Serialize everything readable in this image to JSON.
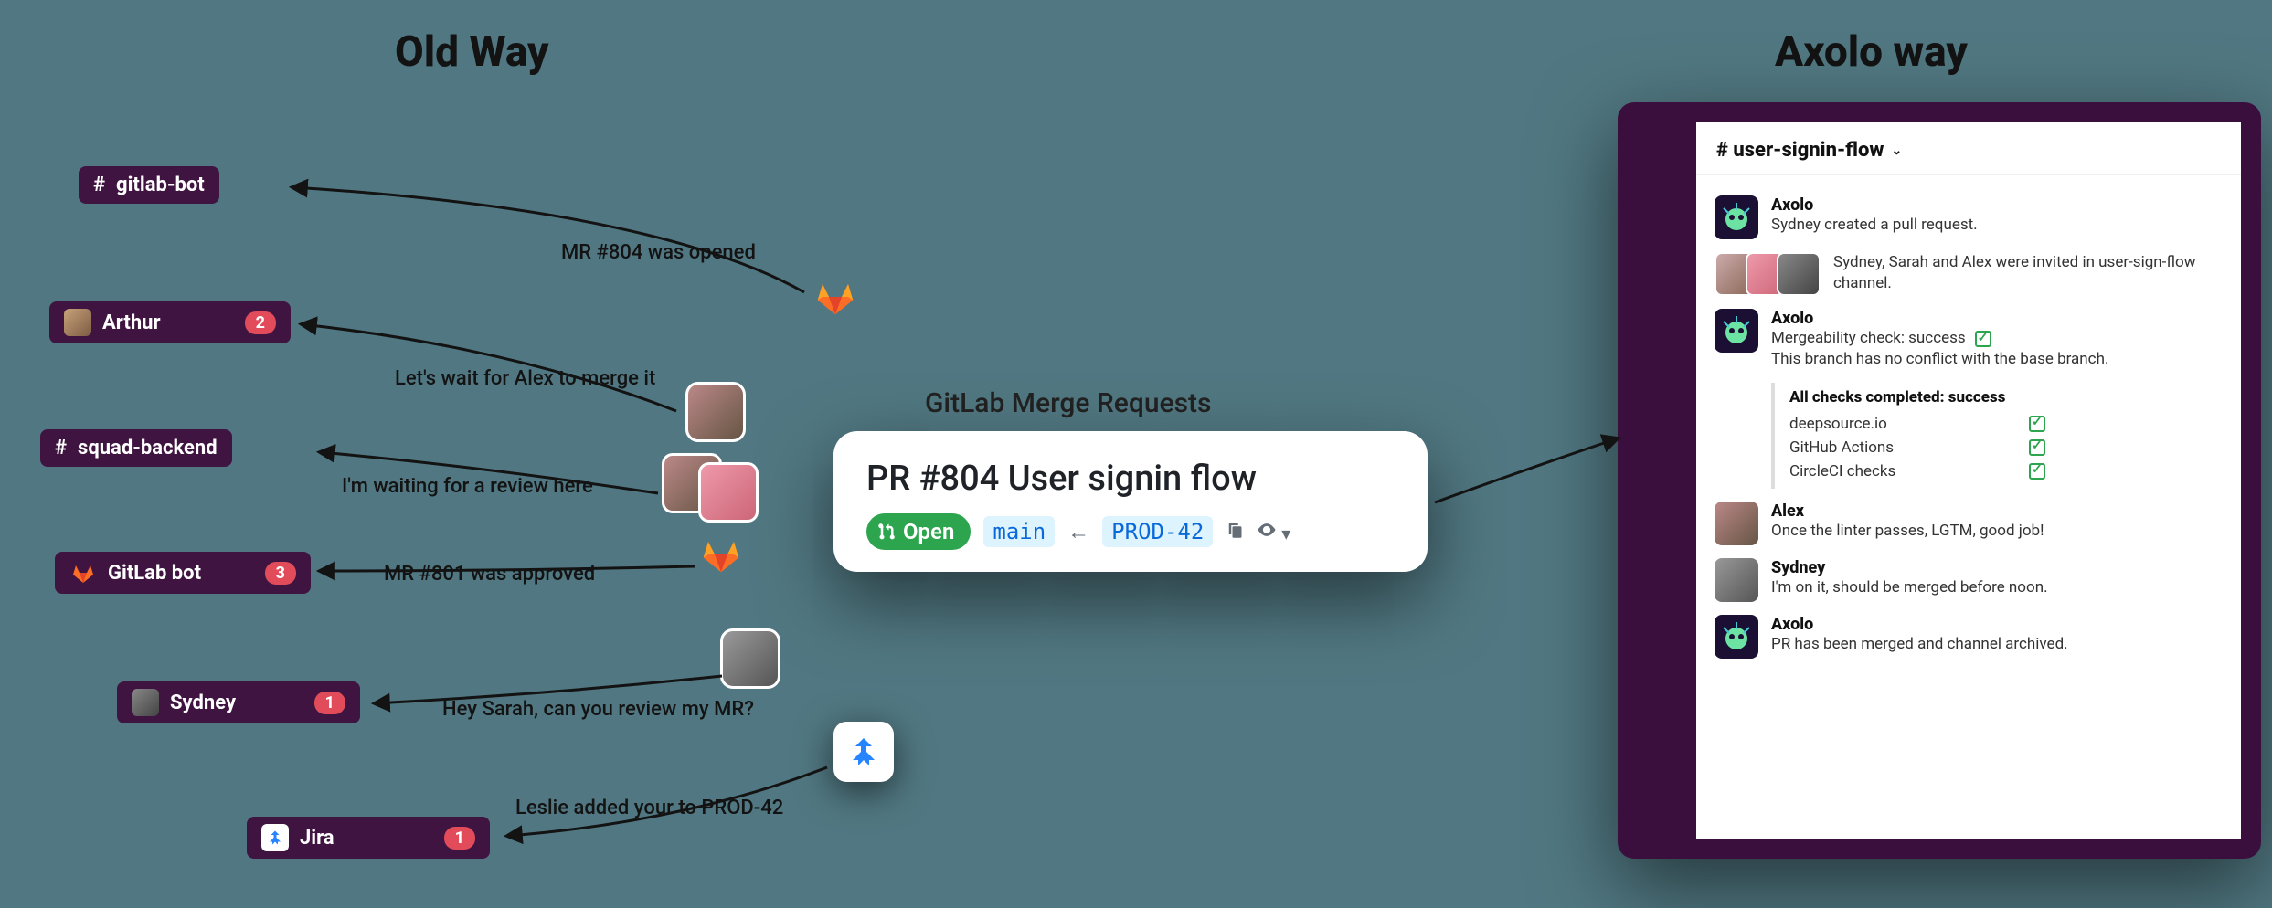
{
  "headings": {
    "old": "Old Way",
    "axolo": "Axolo way"
  },
  "oldChannels": [
    {
      "icon": "#",
      "label": "gitlab-bot",
      "badge": null
    },
    {
      "icon": "avatar",
      "label": "Arthur",
      "badge": "2"
    },
    {
      "icon": "#",
      "label": "squad-backend",
      "badge": null
    },
    {
      "icon": "gitlab",
      "label": "GitLab bot",
      "badge": "3"
    },
    {
      "icon": "avatar2",
      "label": "Sydney",
      "badge": "1"
    },
    {
      "icon": "jira",
      "label": "Jira",
      "badge": "1"
    }
  ],
  "oldNotes": {
    "n1": "MR #804 was opened",
    "n2": "Let's wait for Alex to merge it",
    "n3": "I'm waiting for a review here",
    "n4": "MR #801 was approved",
    "n5": "Hey Sarah, can you review my MR?",
    "n6": "Leslie added your to PROD-42"
  },
  "center": {
    "title": "GitLab Merge Requests",
    "prTitle": "PR #804 User signin flow",
    "openLabel": "Open",
    "branchBase": "main",
    "branchSource": "PROD-42"
  },
  "slack": {
    "channel": "# user-signin-flow",
    "messages": [
      {
        "avatar": "axolo",
        "name": "Axolo",
        "body": "Sydney created a pull request."
      },
      {
        "avatar": "photos",
        "name": "",
        "body": "Sydney, Sarah and Alex were invited in user-sign-flow channel."
      },
      {
        "avatar": "axolo",
        "name": "Axolo",
        "body": "Mergeability check: success",
        "hasCheck": true,
        "sub": "This branch has no conflict with the base branch."
      }
    ],
    "checks": {
      "title": "All checks completed: success",
      "items": [
        "deepsource.io",
        "GitHub Actions",
        "CircleCI checks"
      ]
    },
    "messages2": [
      {
        "avatar": "alex",
        "name": "Alex",
        "body": "Once the linter passes, LGTM, good job!"
      },
      {
        "avatar": "sydney",
        "name": "Sydney",
        "body": "I'm on it, should be merged before noon."
      },
      {
        "avatar": "axolo",
        "name": "Axolo",
        "body": "PR has been merged and channel archived."
      }
    ]
  }
}
